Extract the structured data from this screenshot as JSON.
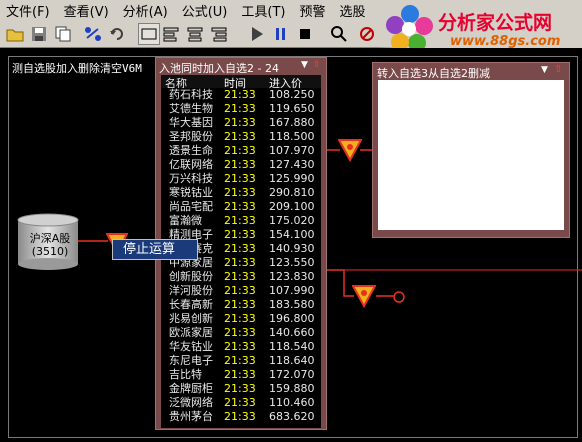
{
  "menu": [
    "文件(F)",
    "查看(V)",
    "分析(A)",
    "公式(U)",
    "工具(T)",
    "预警",
    "选股"
  ],
  "logo": {
    "title": "分析家公式网",
    "url": "www.88gs.com"
  },
  "workspace": {
    "label": "测自选股加入删除清空V6M"
  },
  "cylinder": {
    "name": "沪深A股",
    "count": "(3510)"
  },
  "context_menu": {
    "item": "停止运算"
  },
  "left_panel": {
    "title": "入池同时加入自选2 - 24",
    "headers": {
      "name": "名称",
      "time": "时间",
      "price": "进入价"
    },
    "rows": [
      {
        "name": "药石科技",
        "time": "21:33",
        "price": "108.250"
      },
      {
        "name": "艾德生物",
        "time": "21:33",
        "price": "119.650"
      },
      {
        "name": "华大基因",
        "time": "21:33",
        "price": "167.880"
      },
      {
        "name": "圣邦股份",
        "time": "21:33",
        "price": "118.500"
      },
      {
        "name": "透景生命",
        "time": "21:33",
        "price": "107.970"
      },
      {
        "name": "亿联网络",
        "time": "21:33",
        "price": "127.430"
      },
      {
        "name": "万兴科技",
        "time": "21:33",
        "price": "125.990"
      },
      {
        "name": "寒锐钴业",
        "time": "21:33",
        "price": "290.810"
      },
      {
        "name": "尚品宅配",
        "time": "21:33",
        "price": "209.100"
      },
      {
        "name": "富瀚微",
        "time": "21:33",
        "price": "175.020"
      },
      {
        "name": "精测电子",
        "time": "21:33",
        "price": "154.100"
      },
      {
        "name": "中新赛克",
        "time": "21:33",
        "price": "140.930"
      },
      {
        "name": "中源家居",
        "time": "21:33",
        "price": "123.550"
      },
      {
        "name": "创新股份",
        "time": "21:33",
        "price": "123.830"
      },
      {
        "name": "洋河股份",
        "time": "21:33",
        "price": "107.990"
      },
      {
        "name": "长春高新",
        "time": "21:33",
        "price": "183.580"
      },
      {
        "name": "兆易创新",
        "time": "21:33",
        "price": "196.800"
      },
      {
        "name": "欧派家居",
        "time": "21:33",
        "price": "140.660"
      },
      {
        "name": "华友钴业",
        "time": "21:33",
        "price": "118.540"
      },
      {
        "name": "东尼电子",
        "time": "21:33",
        "price": "118.640"
      },
      {
        "name": "吉比特",
        "time": "21:33",
        "price": "172.070"
      },
      {
        "name": "金牌厨柜",
        "time": "21:33",
        "price": "159.880"
      },
      {
        "name": "泛微网络",
        "time": "21:33",
        "price": "110.460"
      },
      {
        "name": "贵州茅台",
        "time": "21:33",
        "price": "683.620"
      }
    ]
  },
  "right_panel": {
    "title": "转入自选3从自选2删减"
  },
  "colors": {
    "node": "#e83020",
    "panel": "#7a4a4a",
    "time": "#ffff00"
  }
}
